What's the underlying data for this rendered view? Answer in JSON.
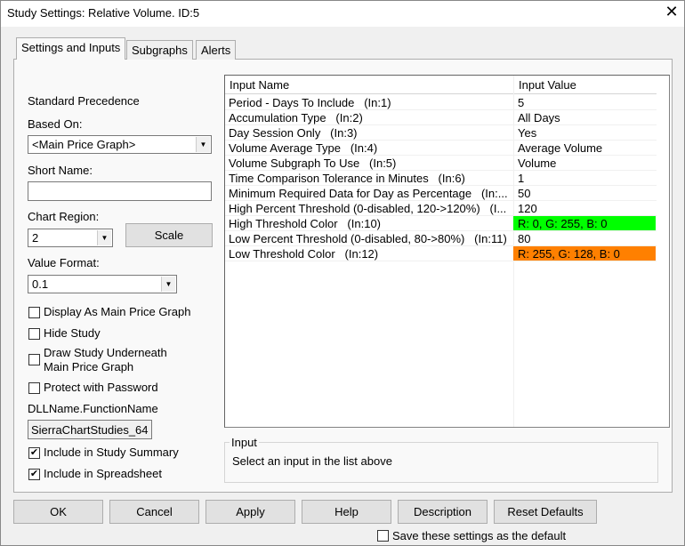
{
  "window": {
    "title": "Study Settings: Relative Volume. ID:5",
    "close": "✕"
  },
  "tabs": [
    "Settings and Inputs",
    "Subgraphs",
    "Alerts"
  ],
  "left": {
    "standard_precedence": "Standard Precedence",
    "based_on_label": "Based On:",
    "based_on_value": "<Main Price Graph>",
    "short_name_label": "Short Name:",
    "short_name_value": "",
    "chart_region_label": "Chart Region:",
    "chart_region_value": "2",
    "scale_button": "Scale",
    "value_format_label": "Value Format:",
    "value_format_value": "0.1",
    "checkboxes": [
      {
        "label": "Display As Main Price Graph",
        "checked": false
      },
      {
        "label": "Hide Study",
        "checked": false
      },
      {
        "label": "Draw Study Underneath",
        "label2": "Main Price Graph",
        "checked": false
      },
      {
        "label": "Protect with Password",
        "checked": false
      }
    ],
    "dll_label": "DLLName.FunctionName",
    "dll_value": "SierraChartStudies_64",
    "include_summary": "Include in Study Summary",
    "include_spreadsheet": "Include in Spreadsheet"
  },
  "table": {
    "headers": [
      "Input Name",
      "Input Value"
    ],
    "rows": [
      {
        "name": "Period - Days To Include   (In:1)",
        "value": "5"
      },
      {
        "name": "Accumulation Type   (In:2)",
        "value": "All Days"
      },
      {
        "name": "Day Session Only   (In:3)",
        "value": "Yes"
      },
      {
        "name": "Volume Average Type   (In:4)",
        "value": "Average Volume"
      },
      {
        "name": "Volume Subgraph To Use   (In:5)",
        "value": "Volume"
      },
      {
        "name": "Time Comparison Tolerance in Minutes   (In:6)",
        "value": "1"
      },
      {
        "name": "Minimum Required Data for Day as Percentage   (In:...",
        "value": "50"
      },
      {
        "name": "High Percent Threshold (0-disabled, 120->120%)   (I...",
        "value": "120"
      },
      {
        "name": "High Threshold Color   (In:10)",
        "value": "R: 0, G: 255, B: 0",
        "color": "#00ff00"
      },
      {
        "name": "Low Percent Threshold (0-disabled, 80->80%)   (In:11)",
        "value": "80"
      },
      {
        "name": "Low Threshold Color   (In:12)",
        "value": "R: 255, G: 128, B: 0",
        "color": "#ff8000"
      }
    ]
  },
  "input_group": {
    "title": "Input",
    "text": "Select an input in the list above"
  },
  "buttons": [
    "OK",
    "Cancel",
    "Apply",
    "Help",
    "Description",
    "Reset Defaults"
  ],
  "save_default": "Save these settings as the default"
}
